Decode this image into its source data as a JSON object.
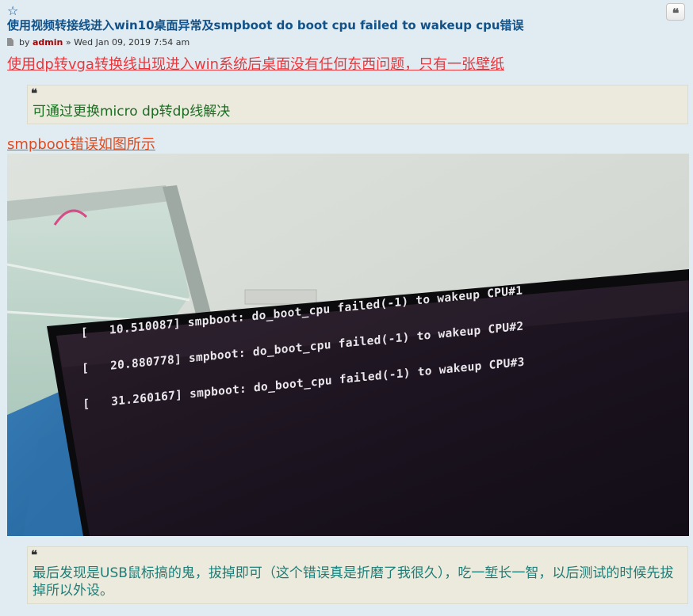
{
  "post": {
    "title": "使用视频转接线进入win10桌面异常及smpboot do boot cpu failed to wakeup cpu错误",
    "meta_by": "by ",
    "author": "admin",
    "meta_sep": " » ",
    "date": "Wed Jan 09, 2019 7:54 am",
    "star_icon": "☆",
    "quote_icon": "❝"
  },
  "content": {
    "line1": "使用dp转vga转换线出现进入win系统后桌面没有任何东西问题，只有一张壁纸",
    "quote1_mark": "❝",
    "quote1": "可通过更换micro dp转dp线解决",
    "line2": "smpboot错误如图所示",
    "boot_log": [
      "[   10.510087] smpboot: do_boot_cpu failed(-1) to wakeup CPU#1",
      "[   20.880778] smpboot: do_boot_cpu failed(-1) to wakeup CPU#2",
      "[   31.260167] smpboot: do_boot_cpu failed(-1) to wakeup CPU#3"
    ],
    "quote2_mark": "❝",
    "quote2": "最后发现是USB鼠标搞的鬼，拔掉即可（这个错误真是折磨了我很久），吃一堑长一智，以后测试的时候先拔掉所以外设。"
  },
  "colors": {
    "background": "#e1ebf2",
    "title": "#105289",
    "author": "#aa0000",
    "red_text": "#e8383d",
    "orange_text": "#e24b1d",
    "quote_green": "#1b6d22",
    "quote_teal": "#1e7d77",
    "quote_bg": "#ebeadd"
  }
}
